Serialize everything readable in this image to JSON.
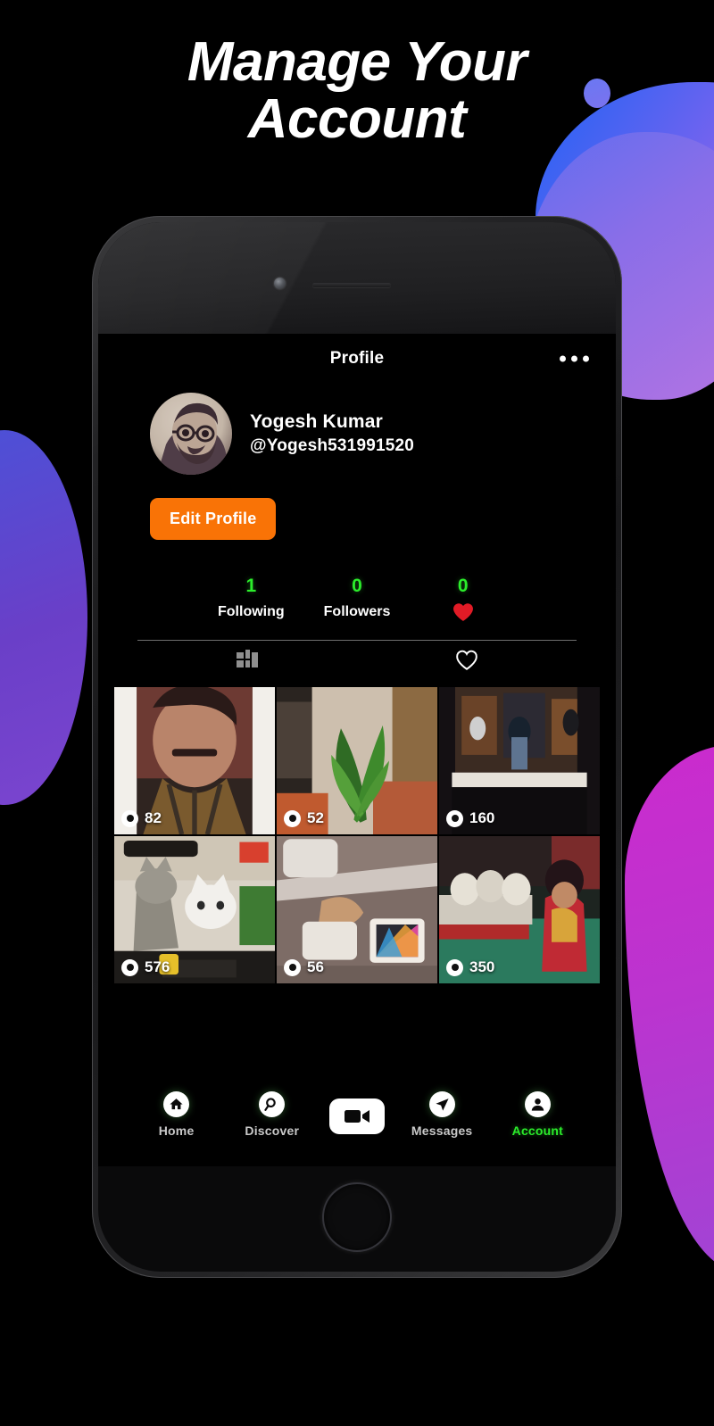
{
  "headline": {
    "line1": "Manage Your",
    "line2": "Account"
  },
  "colors": {
    "accent_orange": "#f97306",
    "accent_green": "#2bed2b",
    "heart_red": "#e11b26",
    "blob_blue": "#1f63f5",
    "blob_purple": "#7b45cf",
    "blob_magenta": "#cb2bcd",
    "screen_bg": "#000000"
  },
  "app": {
    "header": {
      "title": "Profile",
      "menu_icon": "more-horizontal-icon"
    },
    "profile": {
      "avatar_icon": "user-avatar-photo",
      "display_name": "Yogesh Kumar",
      "handle": "@Yogesh531991520",
      "edit_button_label": "Edit Profile"
    },
    "stats": [
      {
        "value": "1",
        "label": "Following",
        "icon": ""
      },
      {
        "value": "0",
        "label": "Followers",
        "icon": ""
      },
      {
        "value": "0",
        "label": "",
        "icon": "heart-filled-icon"
      }
    ],
    "content_tabs": [
      {
        "icon": "grid-layout-icon",
        "active": true
      },
      {
        "icon": "heart-outline-icon",
        "active": false
      }
    ],
    "videos": [
      {
        "views": "82",
        "thumb": "portrait-man-selfie"
      },
      {
        "views": "52",
        "thumb": "green-plant-pot"
      },
      {
        "views": "160",
        "thumb": "night-street-shopfront"
      },
      {
        "views": "576",
        "thumb": "two-cats-meme"
      },
      {
        "views": "56",
        "thumb": "unboxing-tablet-box"
      },
      {
        "views": "350",
        "thumb": "woman-red-saree-dance"
      }
    ],
    "bottom_nav": [
      {
        "label": "Home",
        "icon": "home-icon",
        "active": false
      },
      {
        "label": "Discover",
        "icon": "search-icon",
        "active": false
      },
      {
        "label": "",
        "icon": "video-camera-icon",
        "active": false,
        "center": true
      },
      {
        "label": "Messages",
        "icon": "send-icon",
        "active": false
      },
      {
        "label": "Account",
        "icon": "person-icon",
        "active": true
      }
    ]
  },
  "device": {
    "camera_icon": "front-camera-dot",
    "speaker_icon": "earpiece-speaker",
    "home_button_icon": "home-button"
  }
}
